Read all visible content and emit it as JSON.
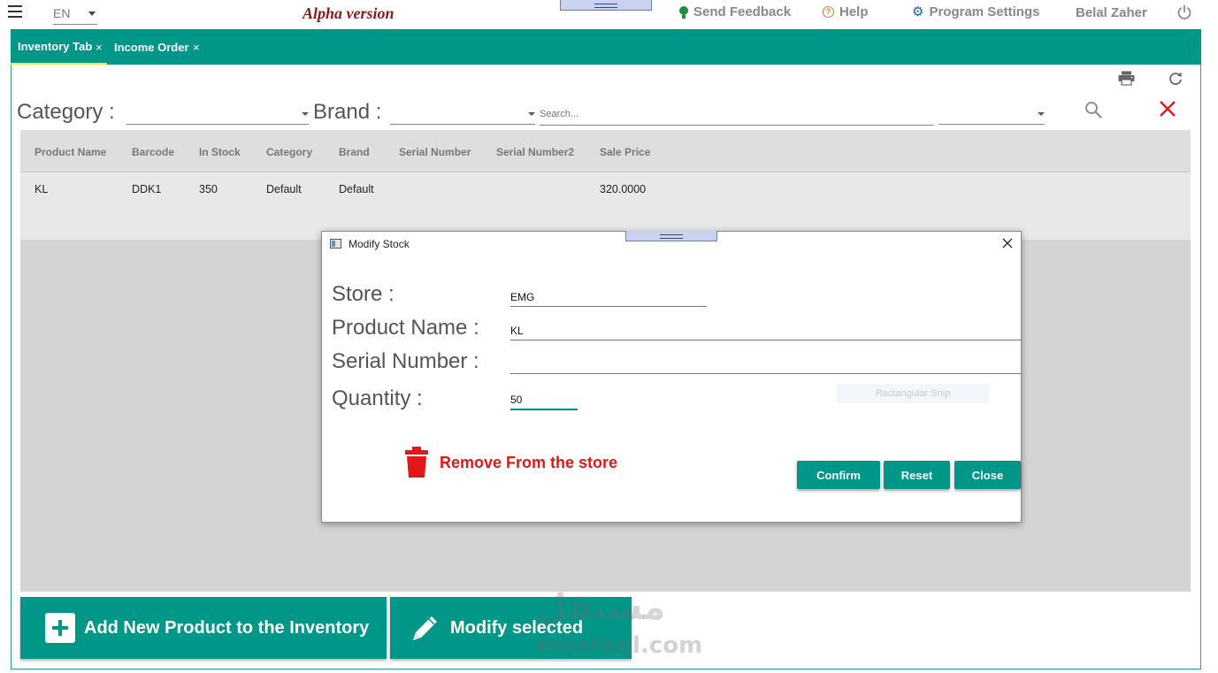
{
  "topbar": {
    "language": "EN",
    "version_label": "Alpha version",
    "feedback_label": "Send Feedback",
    "help_label": "Help",
    "settings_label": "Program Settings",
    "user_name": "Belal Zaher"
  },
  "tabs": [
    {
      "label": "Inventory Tab",
      "close": "×",
      "active": true
    },
    {
      "label": "Income Order",
      "close": "×",
      "active": false
    }
  ],
  "filters": {
    "category_label": "Category :",
    "category_value": "",
    "brand_label": "Brand :",
    "brand_value": "",
    "search_placeholder": "Search...",
    "search_field_value": ""
  },
  "grid": {
    "columns": [
      "Product Name",
      "Barcode",
      "In Stock",
      "Category",
      "Brand",
      "Serial Number",
      "Serial Number2",
      "Sale Price"
    ],
    "rows": [
      [
        "KL",
        "DDK1",
        "350",
        "Default",
        "Default",
        "",
        "",
        "320.0000"
      ]
    ]
  },
  "actions": {
    "add_product_label": "Add New Product to the Inventory",
    "modify_label": "Modify selected"
  },
  "watermark": {
    "arabic": "مستقل",
    "latin": "mostaql.com"
  },
  "dialog": {
    "title": "Modify Stock",
    "store_label": "Store :",
    "store_value": "EMG",
    "product_label": "Product Name :",
    "product_value": "KL",
    "serial_label": "Serial Number :",
    "serial_value": "",
    "quantity_label": "Quantity :",
    "quantity_value": "50",
    "remove_label": "Remove From the store",
    "snip_hint": "Rectangular Snip",
    "confirm_label": "Confirm",
    "reset_label": "Reset",
    "close_label": "Close"
  },
  "colors": {
    "accent": "#009688",
    "danger": "#e41616",
    "alpha_text": "#8b1a1a",
    "grid_bg": "#d4d4d4"
  }
}
